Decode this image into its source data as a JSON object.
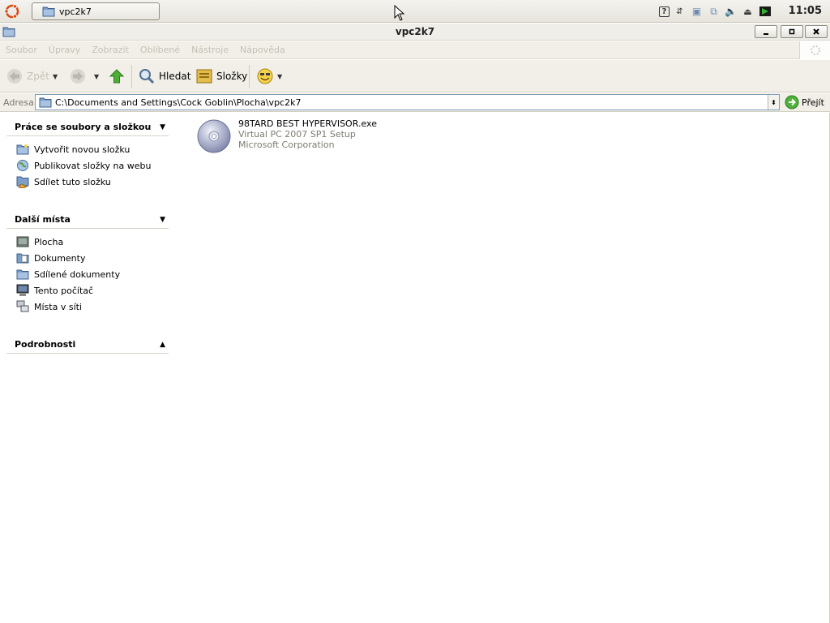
{
  "panel": {
    "task_button_label": "vpc2k7",
    "clock": "11:05"
  },
  "window": {
    "title": "vpc2k7"
  },
  "menu": {
    "items": [
      "Soubor",
      "Úpravy",
      "Zobrazit",
      "Oblíbené",
      "Nástroje",
      "Nápověda"
    ]
  },
  "toolbar": {
    "back_label": "Zpět",
    "search_label": "Hledat",
    "folders_label": "Složky"
  },
  "address": {
    "label": "Adresa",
    "path": "C:\\Documents and Settings\\Cock Goblin\\Plocha\\vpc2k7",
    "go_label": "Přejít"
  },
  "left_pane": {
    "file_tasks": {
      "title": "Práce se soubory a složkou",
      "items": [
        "Vytvořit novou složku",
        "Publikovat složky na webu",
        "Sdílet tuto složku"
      ]
    },
    "other_places": {
      "title": "Další místa",
      "items": [
        "Plocha",
        "Dokumenty",
        "Sdílené dokumenty",
        "Tento počítač",
        "Místa v síti"
      ]
    },
    "details": {
      "title": "Podrobnosti"
    }
  },
  "files": [
    {
      "name": "98TARD BEST HYPERVISOR.exe",
      "description": "Virtual PC 2007 SP1 Setup",
      "company": "Microsoft Corporation"
    }
  ]
}
